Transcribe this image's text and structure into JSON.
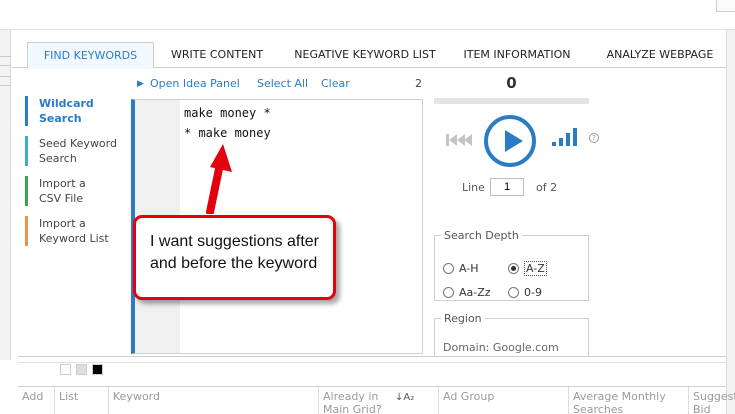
{
  "tabs": [
    {
      "label": "FIND KEYWORDS",
      "active": true
    },
    {
      "label": "WRITE CONTENT",
      "active": false
    },
    {
      "label": "NEGATIVE KEYWORD LIST",
      "active": false
    },
    {
      "label": "ITEM INFORMATION",
      "active": false
    },
    {
      "label": "ANALYZE WEBPAGE",
      "active": false
    }
  ],
  "toolbar": {
    "play_glyph": "▶",
    "open_idea_panel": "Open Idea Panel",
    "select_all": "Select All",
    "clear": "Clear",
    "line_count": "2"
  },
  "nav": [
    {
      "label": "Wildcard\nSearch",
      "active": true,
      "color": "#2a7dc5"
    },
    {
      "label": "Seed Keyword\nSearch",
      "active": false,
      "color": "#3ab0c8"
    },
    {
      "label": "Import a\nCSV File",
      "active": false,
      "color": "#3aa64a"
    },
    {
      "label": "Import a\nKeyword List",
      "active": false,
      "color": "#e8944a"
    }
  ],
  "editor": {
    "lines": [
      "make money *",
      "* make money"
    ]
  },
  "player": {
    "counter": "0",
    "line_label": "Line",
    "line_value": "1",
    "line_of": "of 2",
    "help_glyph": "?"
  },
  "search_depth": {
    "legend": "Search Depth",
    "options": [
      {
        "label": "A-H",
        "selected": false
      },
      {
        "label": "A-Z",
        "selected": true
      },
      {
        "label": "Aa-Zz",
        "selected": false
      },
      {
        "label": "0-9",
        "selected": false
      }
    ]
  },
  "region": {
    "legend": "Region",
    "domain": "Domain: Google.com"
  },
  "grid": {
    "columns": [
      "Add",
      "List",
      "Keyword",
      "Already in\nMain Grid?",
      "Ad Group",
      "Average Monthly\nSearches",
      "Suggest\nBid"
    ],
    "sort_glyph": "↓A₂"
  },
  "annotation": {
    "text": "I want suggestions after and before the keyword"
  },
  "colors": {
    "accent": "#2a7dc5",
    "annotation_red": "#e3000f"
  }
}
